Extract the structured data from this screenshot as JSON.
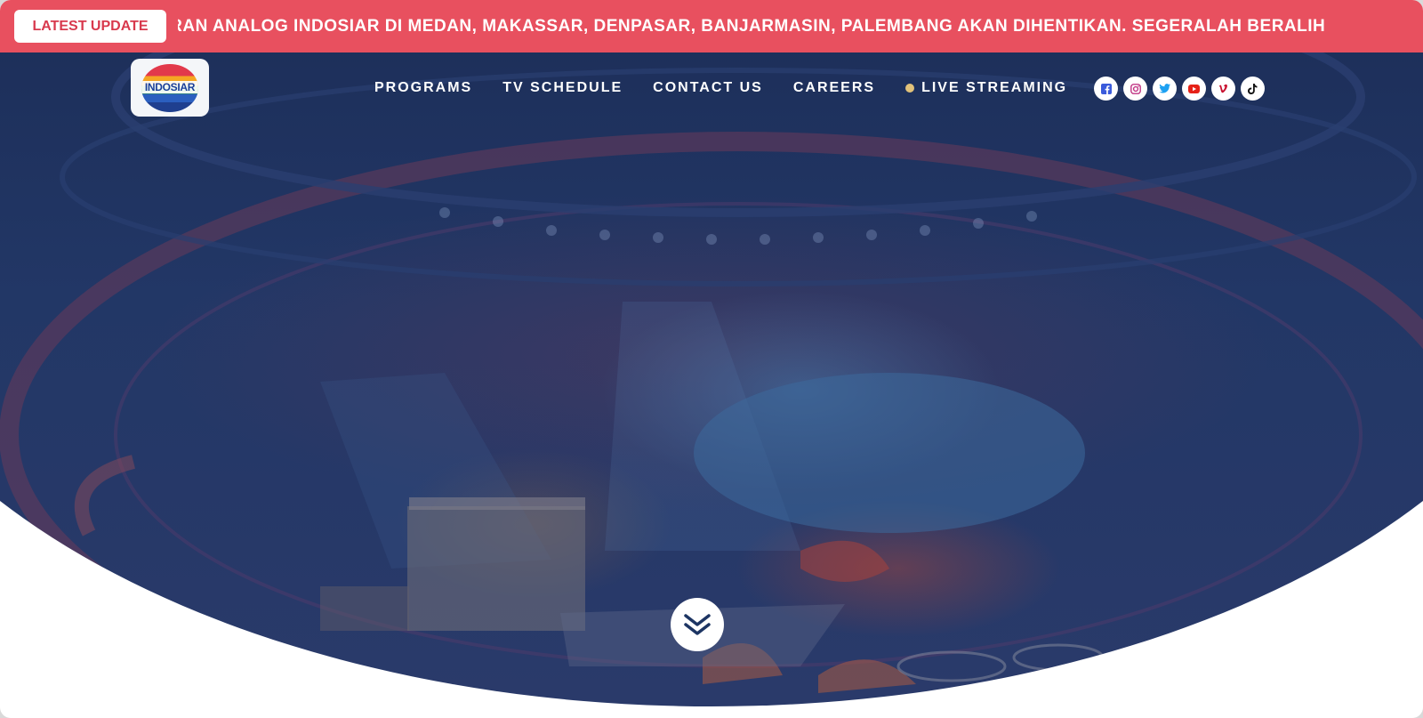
{
  "ticker": {
    "badge_label": "LATEST UPDATE",
    "message": "SIARAN ANALOG INDOSIAR DI MEDAN, MAKASSAR, DENPASAR, BANJARMASIN, PALEMBANG AKAN DIHENTIKAN. SEGERALAH BERALIH"
  },
  "logo": {
    "text": "INDOSIAR"
  },
  "nav": {
    "items": [
      {
        "label": "PROGRAMS"
      },
      {
        "label": "TV SCHEDULE"
      },
      {
        "label": "CONTACT US"
      },
      {
        "label": "CAREERS"
      },
      {
        "label": "LIVE STREAMING"
      }
    ]
  },
  "socials": [
    {
      "icon": "facebook-icon",
      "color": "#3b5bdb"
    },
    {
      "icon": "instagram-icon",
      "color": "#c13584"
    },
    {
      "icon": "twitter-icon",
      "color": "#1da1f2"
    },
    {
      "icon": "youtube-icon",
      "color": "#e62117"
    },
    {
      "icon": "vimeo-icon",
      "color": "#c8102e"
    },
    {
      "icon": "tiktok-icon",
      "color": "#111111"
    }
  ],
  "colors": {
    "ticker_bg": "#e8505f",
    "badge_text": "#d8394d",
    "hero_overlay": "#1d2f5a",
    "live_dot": "#e2c27a"
  },
  "scroll_button": {
    "icon": "double-chevron-down-icon"
  }
}
